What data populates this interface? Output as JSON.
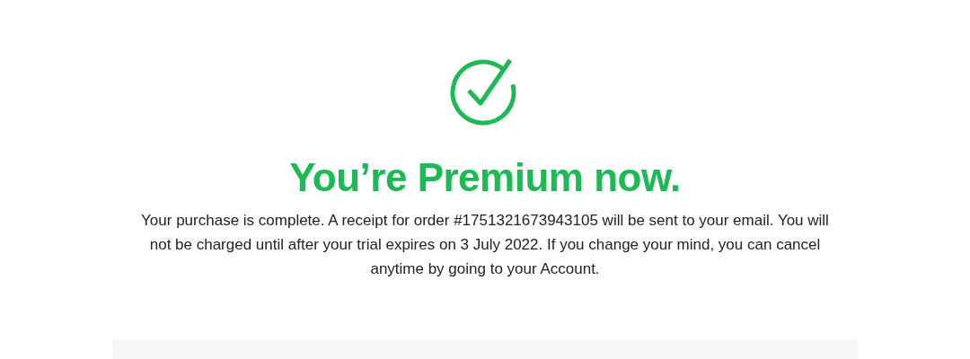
{
  "title": "You’re Premium now.",
  "message": "Your purchase is complete. A receipt for order #1751321673943105 will be sent to your email. You will not be charged until after your trial expires on 3 July 2022. If you change your mind, you can cancel anytime by going to your Account."
}
